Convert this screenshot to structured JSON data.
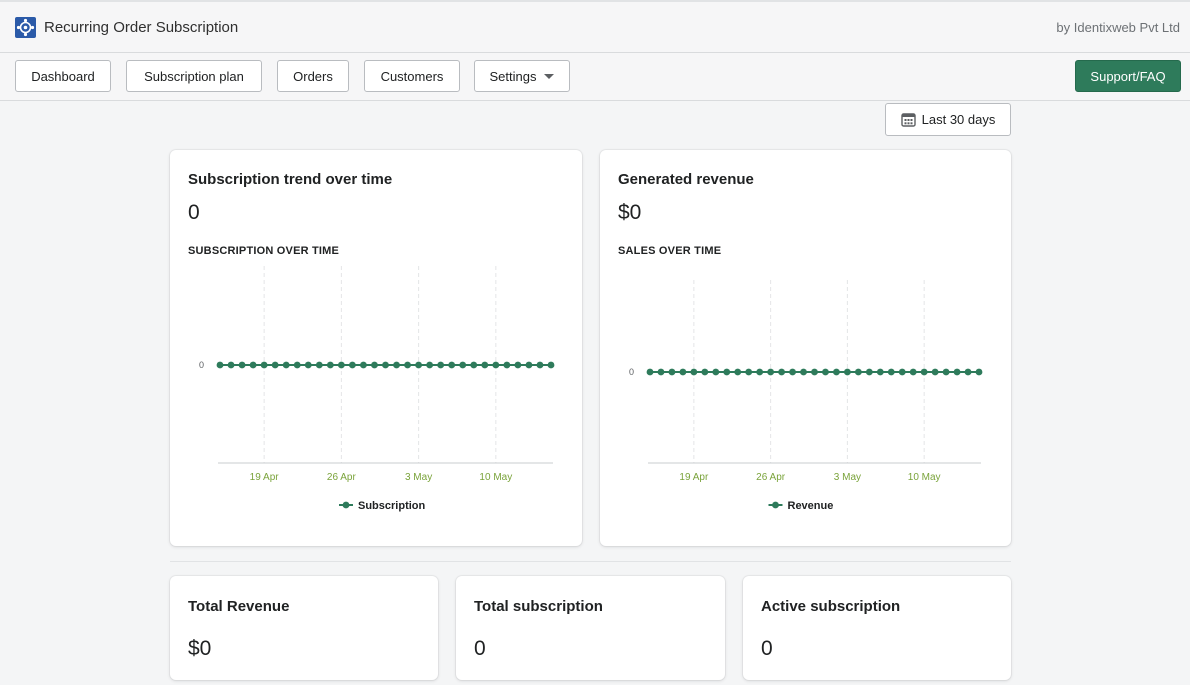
{
  "header": {
    "app_title": "Recurring Order Subscription",
    "vendor": "by Identixweb Pvt Ltd"
  },
  "nav": {
    "dashboard": "Dashboard",
    "subscription_plan": "Subscription plan",
    "orders": "Orders",
    "customers": "Customers",
    "settings": "Settings",
    "support": "Support/FAQ"
  },
  "date_filter": {
    "label": "Last 30 days",
    "icon": "calendar-icon"
  },
  "cards": {
    "subscription_trend": {
      "title": "Subscription trend over time",
      "value": "0",
      "subtitle": "SUBSCRIPTION OVER TIME"
    },
    "generated_revenue": {
      "title": "Generated revenue",
      "value": "$0",
      "subtitle": "SALES OVER TIME"
    }
  },
  "stats": {
    "total_revenue": {
      "title": "Total Revenue",
      "value": "$0"
    },
    "total_subscription": {
      "title": "Total subscription",
      "value": "0"
    },
    "active_subscription": {
      "title": "Active subscription",
      "value": "0"
    }
  },
  "colors": {
    "accent": "#2e7b5b",
    "line": "#2e7b5b",
    "tick": "#7aa33a"
  },
  "chart_data": [
    {
      "type": "line",
      "x_ticks": [
        "19 Apr",
        "26 Apr",
        "3 May",
        "10 May"
      ],
      "y_ticks": [
        "0"
      ],
      "series": [
        {
          "name": "Subscription",
          "values": [
            0,
            0,
            0,
            0,
            0,
            0,
            0,
            0,
            0,
            0,
            0,
            0,
            0,
            0,
            0,
            0,
            0,
            0,
            0,
            0,
            0,
            0,
            0,
            0,
            0,
            0,
            0,
            0,
            0,
            0,
            0
          ]
        }
      ],
      "legend": "bottom-center",
      "grid": "vertical dashed"
    },
    {
      "type": "line",
      "x_ticks": [
        "19 Apr",
        "26 Apr",
        "3 May",
        "10 May"
      ],
      "y_ticks": [
        "0"
      ],
      "series": [
        {
          "name": "Revenue",
          "values": [
            0,
            0,
            0,
            0,
            0,
            0,
            0,
            0,
            0,
            0,
            0,
            0,
            0,
            0,
            0,
            0,
            0,
            0,
            0,
            0,
            0,
            0,
            0,
            0,
            0,
            0,
            0,
            0,
            0,
            0,
            0
          ]
        }
      ],
      "legend": "bottom-center",
      "grid": "vertical dashed"
    }
  ]
}
